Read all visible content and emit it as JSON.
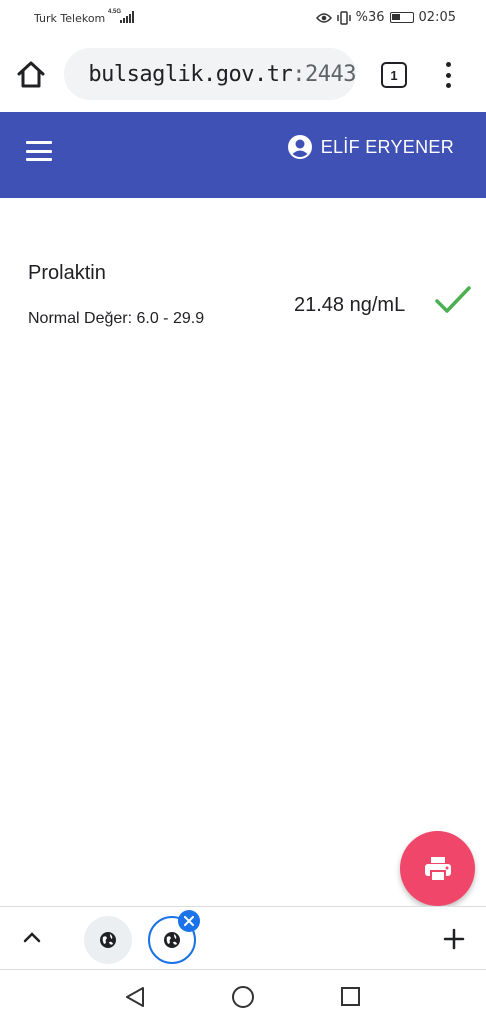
{
  "status_bar": {
    "carrier": "Turk Telekom",
    "network_type": "4.5G",
    "battery_text": "%36",
    "time": "02:05"
  },
  "browser": {
    "url_host": "bulsaglik.gov.tr",
    "url_port": ":2443",
    "tab_count": "1"
  },
  "appbar": {
    "user_name": "ELİF ERYENER",
    "color": "#3f51b5"
  },
  "result": {
    "test_name": "Prolaktin",
    "normal_label": "Normal Değer:",
    "normal_range": "6.0 - 29.9",
    "value": "21.48 ng/mL",
    "status_icon": "check-icon",
    "status_color": "#4caf50"
  },
  "fab": {
    "icon": "print-icon",
    "color": "#f0466a"
  }
}
